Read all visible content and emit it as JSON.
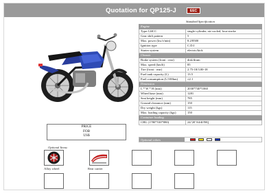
{
  "header": {
    "title": "Quotation for QP125-J",
    "logo_text": "EEC",
    "logo_color": "#9b1d12"
  },
  "spec": {
    "heading": "Standard Specification",
    "sections": [
      {
        "title": "Engine",
        "rows": [
          [
            "Type:124CC",
            "single-cylinder, air-cooled, four-stroke"
          ],
          [
            "Gear shift pattern",
            "5"
          ],
          [
            "Max. power (kw/r/min)",
            "8.2/8500"
          ],
          [
            "Ignition type",
            "C.D.I"
          ],
          [
            "Starter system",
            "electric/kick"
          ]
        ]
      },
      {
        "title": "Chassis",
        "rows": [
          [
            "Brake system (front : rear)",
            "disk/drum"
          ],
          [
            "Max. speed (km/h)",
            "85"
          ],
          [
            "Tire (front : rear)",
            "2.75-18/3.00-18"
          ],
          [
            "Fuel tank capacity (L)",
            "13.5"
          ],
          [
            "Fuel consumption (L/100km)",
            "≤2.1"
          ]
        ]
      },
      {
        "title": "Dimension",
        "rows": [
          [
            "L * W * H (mm)",
            "2030*740*1060"
          ],
          [
            "Wheel base (mm)",
            "1281"
          ],
          [
            "Seat height (mm)",
            "785"
          ],
          [
            "Ground clearance (mm)",
            "150"
          ],
          [
            "Dry weight (kgs)",
            "115"
          ],
          [
            "Max. loading capacity (kgs)",
            "150"
          ]
        ]
      },
      {
        "title": "Container loading",
        "rows": [
          [
            "CBU (1780*530*880)",
            "24/'20'    84/40'HQ"
          ]
        ]
      }
    ]
  },
  "price_box": {
    "line1": "PRICE",
    "line2": "FOB",
    "line3": "US$"
  },
  "optional_colors": {
    "label": "Optional colors",
    "swatches": [
      "#d11a1a",
      "#f2dc00",
      "#ffffff",
      "#1730b3"
    ]
  },
  "optional_items": {
    "label": "Optional Items:",
    "captions": [
      "Alloy wheel",
      "Rear carrier"
    ]
  }
}
